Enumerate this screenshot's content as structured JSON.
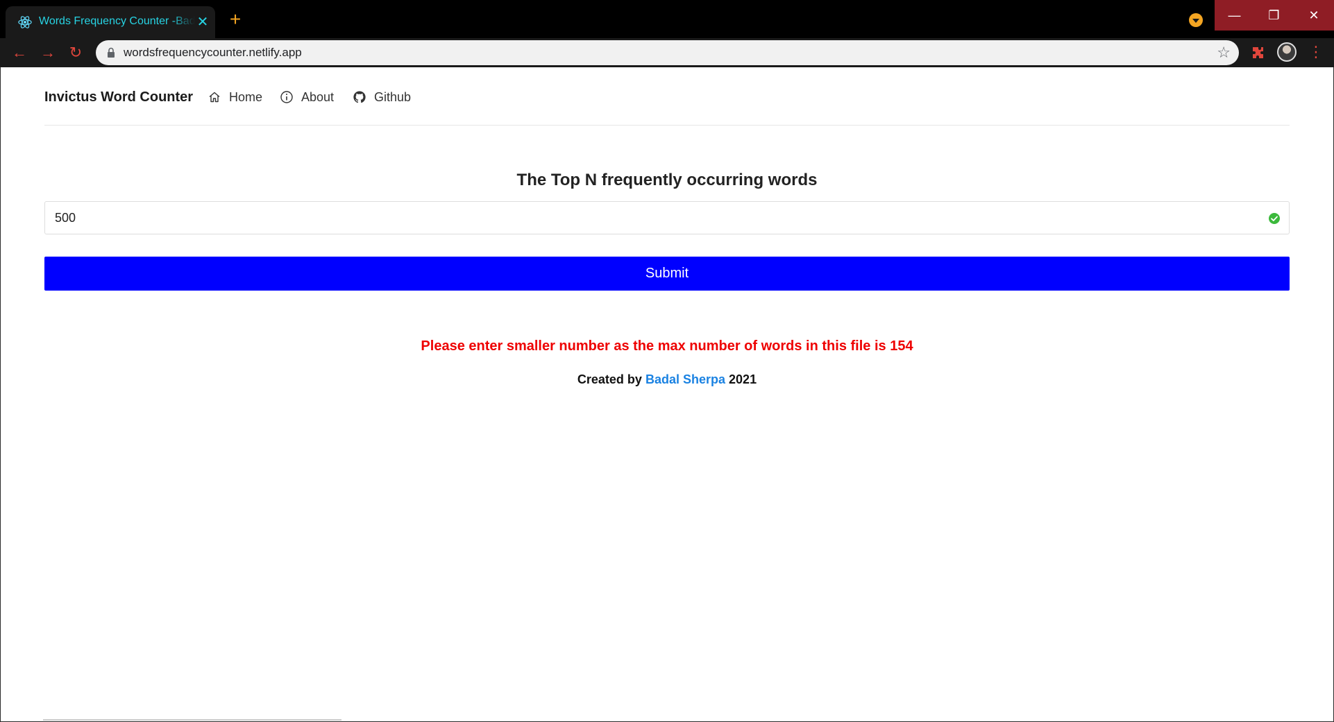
{
  "browser": {
    "tab_title": "Words Frequency Counter -Badal Sherpa",
    "new_tab_symbol": "+",
    "url": "wordsfrequencycounter.netlify.app",
    "accent_colors": {
      "tab_text": "#27d3e3",
      "new_tab": "#f4a522",
      "window_controls": "#8f1d25"
    },
    "icons": [
      "react-icon",
      "close-icon",
      "back-icon",
      "forward-icon",
      "reload-icon",
      "lock-icon",
      "star-icon",
      "extensions-icon",
      "profile-avatar",
      "menu-icon"
    ]
  },
  "nav": {
    "brand": "Invictus Word Counter",
    "links": [
      {
        "label": "Home",
        "icon": "home-icon"
      },
      {
        "label": "About",
        "icon": "info-icon"
      },
      {
        "label": "Github",
        "icon": "github-icon"
      }
    ]
  },
  "main": {
    "heading": "The Top N frequently occurring words",
    "input_value": "500",
    "submit_label": "Submit",
    "submit_color": "#0000ff",
    "error_message": "Please enter smaller number as the max number of words in this file is 154",
    "error_color": "#ee0000"
  },
  "footer": {
    "prefix": "Created by",
    "author": "Badal Sherpa",
    "year": "2021",
    "author_color": "#1a82e2"
  }
}
